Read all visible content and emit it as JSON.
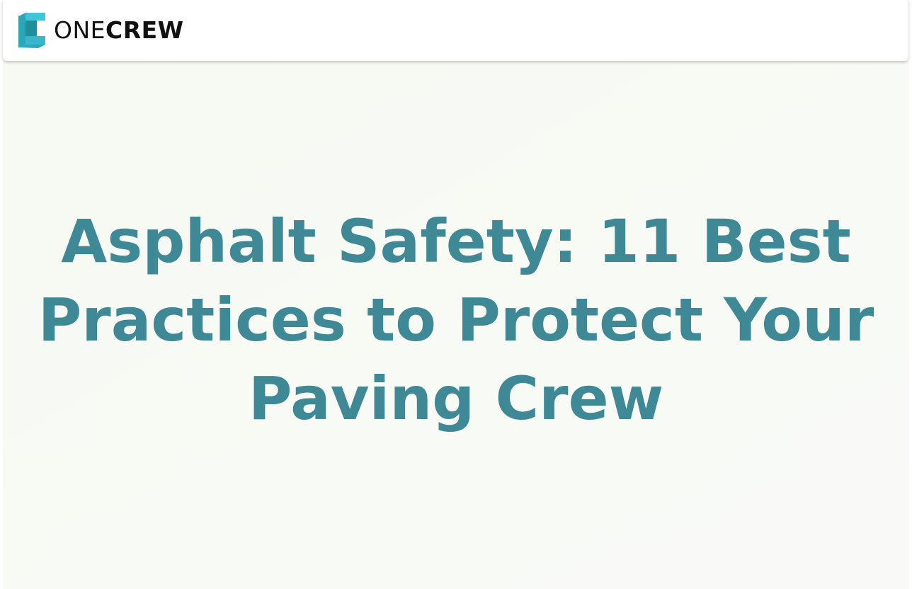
{
  "brand": {
    "name_part_1": "ONE",
    "name_part_2": "CREW",
    "logo_icon": "onecrew-logo-icon",
    "colors": {
      "logo_top": "#3cc6d8",
      "logo_side": "#2aa7b8",
      "logo_dark": "#1f8f9f"
    }
  },
  "hero": {
    "title": "Asphalt Safety: 11 Best Practices to Protect Your Paving Crew",
    "title_color": "#3f8896",
    "background": "#f7faf3"
  }
}
